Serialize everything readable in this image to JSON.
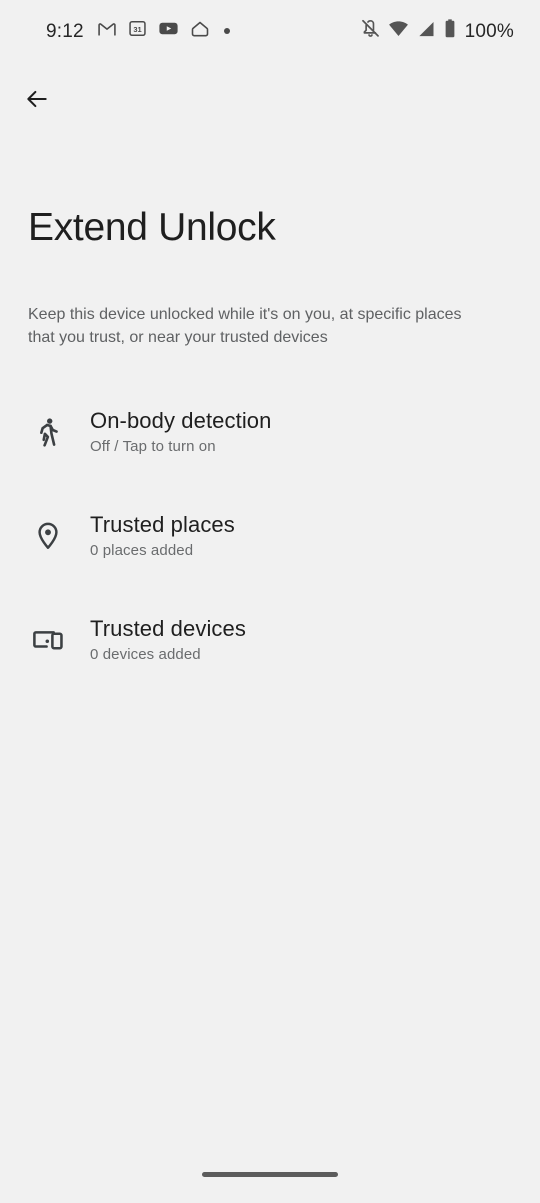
{
  "status_bar": {
    "clock": "9:12",
    "battery_percent": "100%",
    "left_icons": [
      {
        "name": "gmail-icon",
        "label": "M"
      },
      {
        "name": "calendar-icon",
        "label": "31"
      },
      {
        "name": "youtube-icon",
        "label": ""
      },
      {
        "name": "nest-home-icon",
        "label": ""
      },
      {
        "name": "notification-dot-icon",
        "label": ""
      }
    ],
    "right_icons": [
      {
        "name": "notifications-off-icon",
        "label": ""
      },
      {
        "name": "wifi-icon",
        "label": ""
      },
      {
        "name": "cellular-signal-icon",
        "label": ""
      },
      {
        "name": "battery-icon",
        "label": ""
      }
    ]
  },
  "toolbar": {
    "back_label": "Back",
    "back_icon": "arrow-back-icon"
  },
  "header": {
    "title": "Extend Unlock",
    "description": "Keep this device unlocked while it's on you, at specific places that you trust, or near your trusted devices"
  },
  "settings_list": [
    {
      "icon": "walking-person-icon",
      "title": "On-body detection",
      "subtitle": "Off / Tap to turn on"
    },
    {
      "icon": "location-pin-icon",
      "title": "Trusted places",
      "subtitle": "0 places added"
    },
    {
      "icon": "devices-icon",
      "title": "Trusted devices",
      "subtitle": "0 devices added"
    }
  ],
  "nav_bar": {
    "home_indicator": "home-gesture-bar"
  },
  "colors": {
    "background": "#f1f1f1",
    "primary_text": "#1f1f1f",
    "secondary_text": "#5f6163",
    "icon": "#3c4043"
  }
}
